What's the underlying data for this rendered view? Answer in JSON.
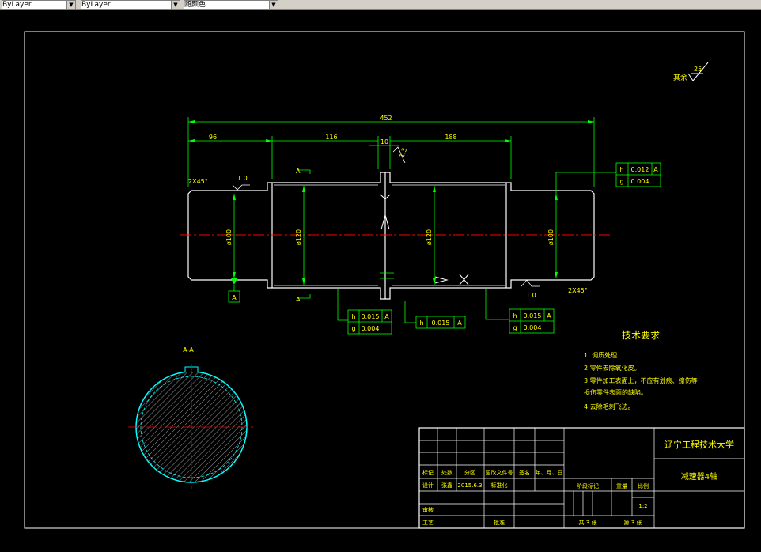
{
  "toolbar": {
    "linetype": "ByLayer",
    "lineweight": "ByLayer",
    "plotstyle": "随颜色"
  },
  "drawing": {
    "roughness_label": "其余",
    "roughness_value": "25",
    "dims": {
      "overall": "452",
      "d96": "96",
      "d116": "116",
      "d10": "10",
      "d188": "188",
      "chamfer_left": "2X45°",
      "chamfer_right": "2X45°",
      "fillet_left": "1.0",
      "fillet_right": "1.0",
      "dia_left": "ø100",
      "dia_mid1": "ø120",
      "dia_mid2": "ø120",
      "dia_right": "ø100",
      "r_note": "1.3",
      "section_label": "A-A",
      "datum": "A",
      "cut_mark": "A"
    },
    "tolerances": {
      "top_right": {
        "sym1": "h",
        "val1": "0.012",
        "ref1": "A",
        "sym2": "g",
        "val2": "0.004"
      },
      "bottom_left": {
        "sym1": "h",
        "val1": "0.015",
        "ref1": "A",
        "sym2": "g",
        "val2": "0.004"
      },
      "bottom_mid": {
        "sym1": "h",
        "val1": "0.015",
        "ref1": "A"
      },
      "bottom_right": {
        "sym1": "h",
        "val1": "0.015",
        "ref1": "A",
        "sym2": "g",
        "val2": "0.004"
      }
    },
    "tech_req": {
      "title": "技术要求",
      "items": [
        "1. 调质处理",
        "2.零件去除氧化皮。",
        "3.零件加工表面上，不应有划痕、擦伤等",
        "损伤零件表面的缺陷。",
        "4.去除毛刺飞边。"
      ]
    },
    "title_block": {
      "school": "辽宁工程技术大学",
      "part_name": "减速器4轴",
      "hdr_biaoji": "标记",
      "hdr_chushu": "处数",
      "hdr_fenqu": "分区",
      "hdr_gengai": "更改文件号",
      "hdr_qianming": "签名",
      "hdr_date": "年、月、日",
      "design_label": "设计",
      "designer": "张鑫",
      "design_date": "2015.6.3",
      "std_label": "标准化",
      "stage_label": "阶段标记",
      "weight_label": "重量",
      "scale_label": "比例",
      "scale": "1:2",
      "review_label": "审核",
      "process_label": "工艺",
      "approve_label": "批准",
      "sheets": "共 3 张",
      "sheet_no": "第 3 张"
    }
  }
}
